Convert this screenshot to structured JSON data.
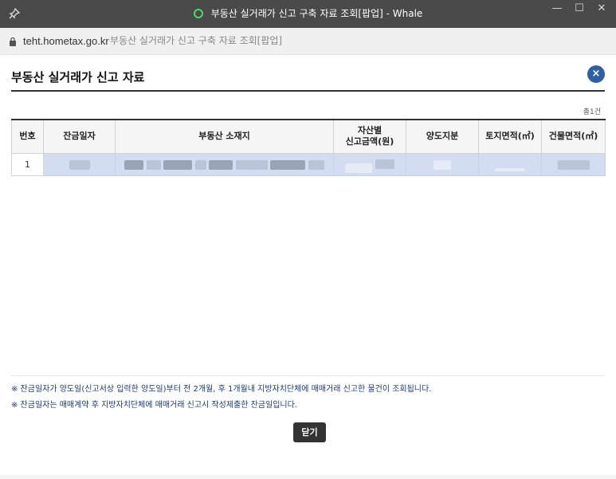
{
  "window": {
    "title": "부동산 실거래가 신고 구축 자료 조회[팝업] - Whale",
    "minimize_label": "—",
    "maximize_label": "☐",
    "close_label": "✕"
  },
  "address": {
    "domain": "teht.hometax.go.kr",
    "page_title": "부동산 실거래가 신고 구축 자료 조회[팝업]"
  },
  "dialog": {
    "heading": "부동산 실거래가 신고 자료",
    "close_icon_label": "×",
    "count": "총1건",
    "close_button_label": "닫기"
  },
  "table": {
    "headers": {
      "num": "번호",
      "payment_date": "잔금일자",
      "location": "부동산 소재지",
      "amount_line1": "자산별",
      "amount_line2": "신고금액(원)",
      "share": "양도지분",
      "land_area": "토지면적(㎡)",
      "building_area": "건물면적(㎡)"
    },
    "rows": [
      {
        "num": "1"
      }
    ]
  },
  "notes": [
    "※ 잔금일자가 양도일(신고서상 입력한 양도일)부터 전 2개월, 후 1개월내 지방자치단체에 매매거래 신고한 물건이 조회됩니다.",
    "※ 잔금일자는 매매계약 후 지방자치단체에 매매거래 신고시 작성제출한 잔금일입니다."
  ],
  "colors": {
    "titlebar": "#4a4a4a",
    "accent": "#2f5fa5",
    "selected_row": "#d2ddf2",
    "note_text": "#1b3a78"
  }
}
